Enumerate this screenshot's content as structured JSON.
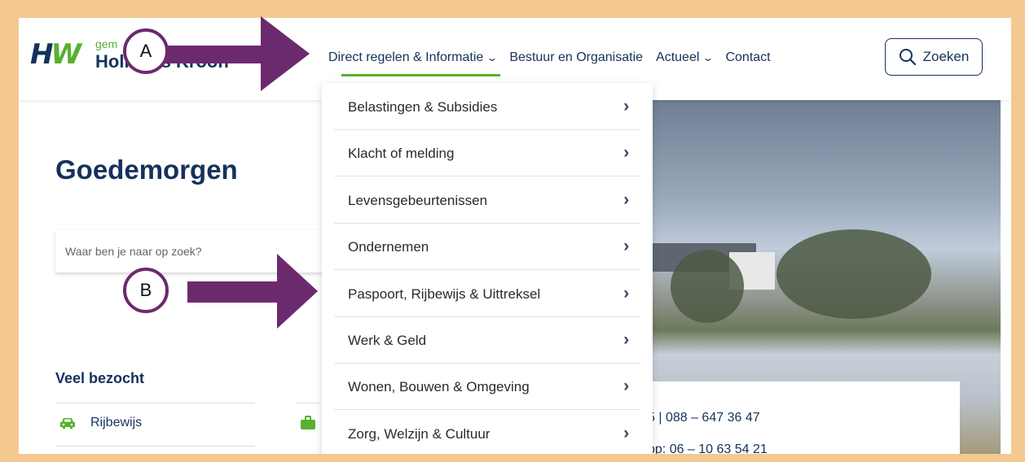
{
  "header": {
    "logo_text_small": "gem",
    "logo_text_big": "Hollands Kroon",
    "nav": [
      {
        "label": "Direct regelen & Informatie",
        "has_dropdown": true,
        "active": true
      },
      {
        "label": "Bestuur en Organisatie",
        "has_dropdown": false
      },
      {
        "label": "Actueel",
        "has_dropdown": true
      },
      {
        "label": "Contact",
        "has_dropdown": false
      }
    ],
    "search_button_label": "Zoeken"
  },
  "dropdown": {
    "items": [
      {
        "label": "Belastingen & Subsidies"
      },
      {
        "label": "Klacht of melding"
      },
      {
        "label": "Levensgebeurtenissen"
      },
      {
        "label": "Ondernemen"
      },
      {
        "label": "Paspoort, Rijbewijs & Uittreksel"
      },
      {
        "label": "Werk & Geld"
      },
      {
        "label": "Wonen, Bouwen & Omgeving"
      },
      {
        "label": "Zorg, Welzijn & Cultuur"
      }
    ]
  },
  "main": {
    "greeting": "Goedemorgen",
    "search_placeholder": "Waar ben je naar op zoek?",
    "visited_title": "Veel bezocht",
    "visited_items": [
      {
        "label": "Rijbewijs",
        "icon": "car-icon"
      }
    ],
    "info_line1": "5 | 088 – 647 36 47",
    "info_line2": "pp: 06 – 10 63 54 21"
  },
  "annotations": [
    {
      "label": "A"
    },
    {
      "label": "B"
    }
  ],
  "colors": {
    "brand_navy": "#15315b",
    "brand_green": "#57b12f",
    "annotation_purple": "#6b2a6e",
    "frame": "#f3c891"
  }
}
